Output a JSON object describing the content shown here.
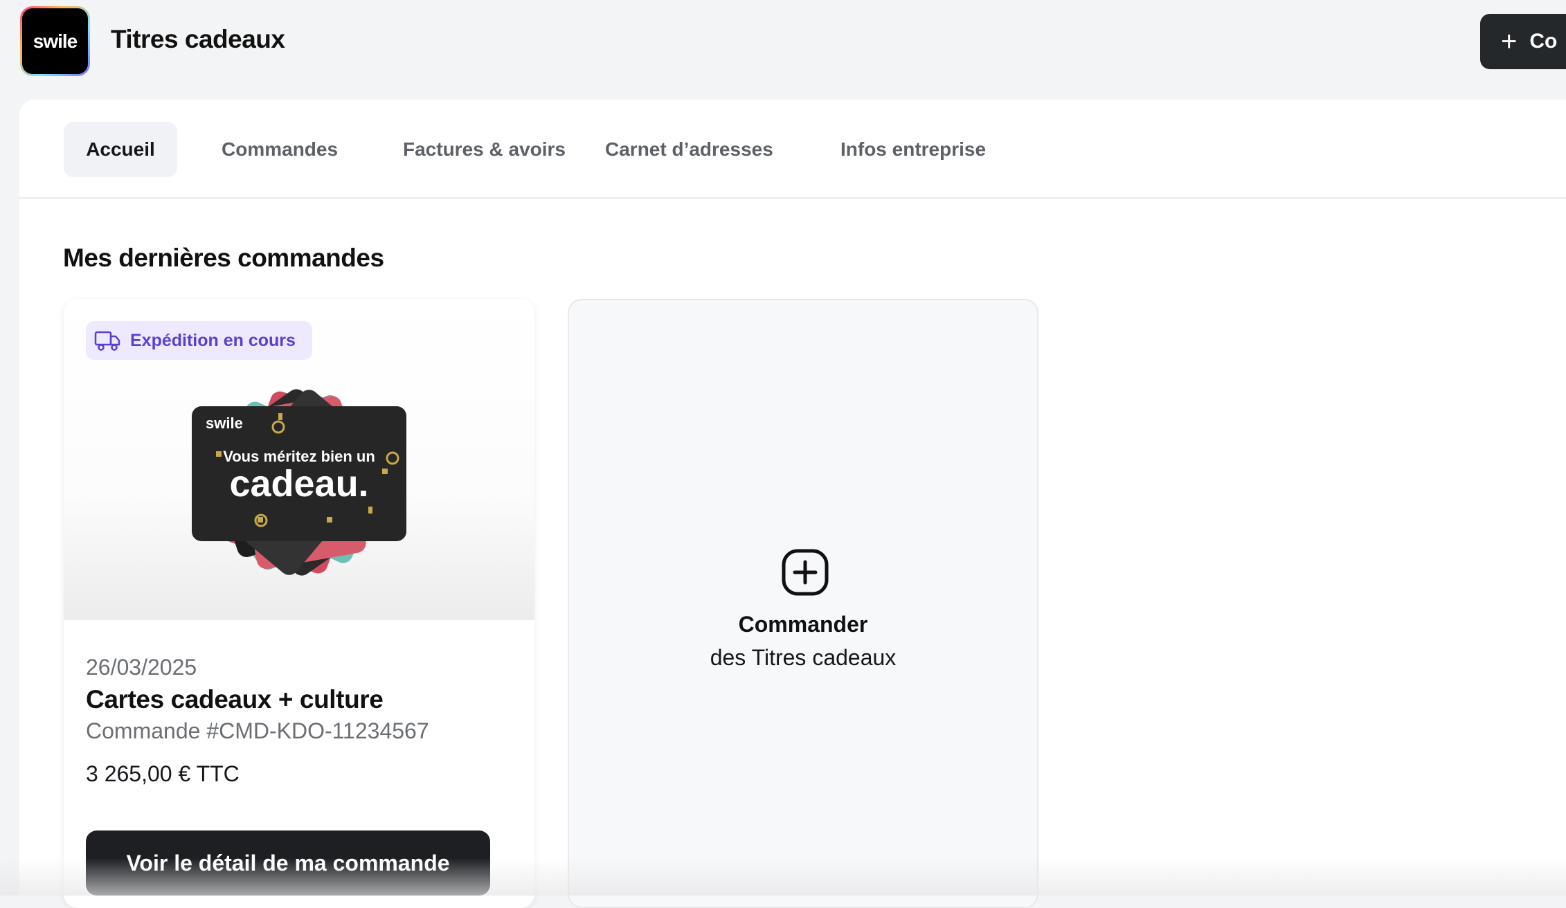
{
  "header": {
    "logo_text": "swile",
    "title": "Titres cadeaux",
    "cta_icon": "plus-icon",
    "cta_label": "Co"
  },
  "tabs": [
    {
      "label": "Accueil",
      "active": true
    },
    {
      "label": "Commandes",
      "active": false
    },
    {
      "label": "Factures & avoirs",
      "active": false
    },
    {
      "label": "Carnet d’adresses",
      "active": false
    },
    {
      "label": "Infos entreprise",
      "active": false
    }
  ],
  "section": {
    "title": "Mes dernières commandes"
  },
  "order": {
    "status": "Expédition en cours",
    "status_icon": "truck-icon",
    "image_text": {
      "brand": "swile",
      "line1": "Vous méritez bien un",
      "line2": "cadeau."
    },
    "date": "26/03/2025",
    "name": "Cartes cadeaux + culture",
    "reference": "Commande #CMD-KDO-11234567",
    "total": "3 265,00 € TTC",
    "button_label": "Voir le détail de ma commande"
  },
  "new_order": {
    "icon": "plus-square-icon",
    "title": "Commander",
    "subtitle": "des Titres cadeaux"
  },
  "colors": {
    "background": "#f3f4f6",
    "dark_button": "#1d1f22",
    "status_bg": "#eee9fc",
    "status_text": "#5b3fd1"
  }
}
